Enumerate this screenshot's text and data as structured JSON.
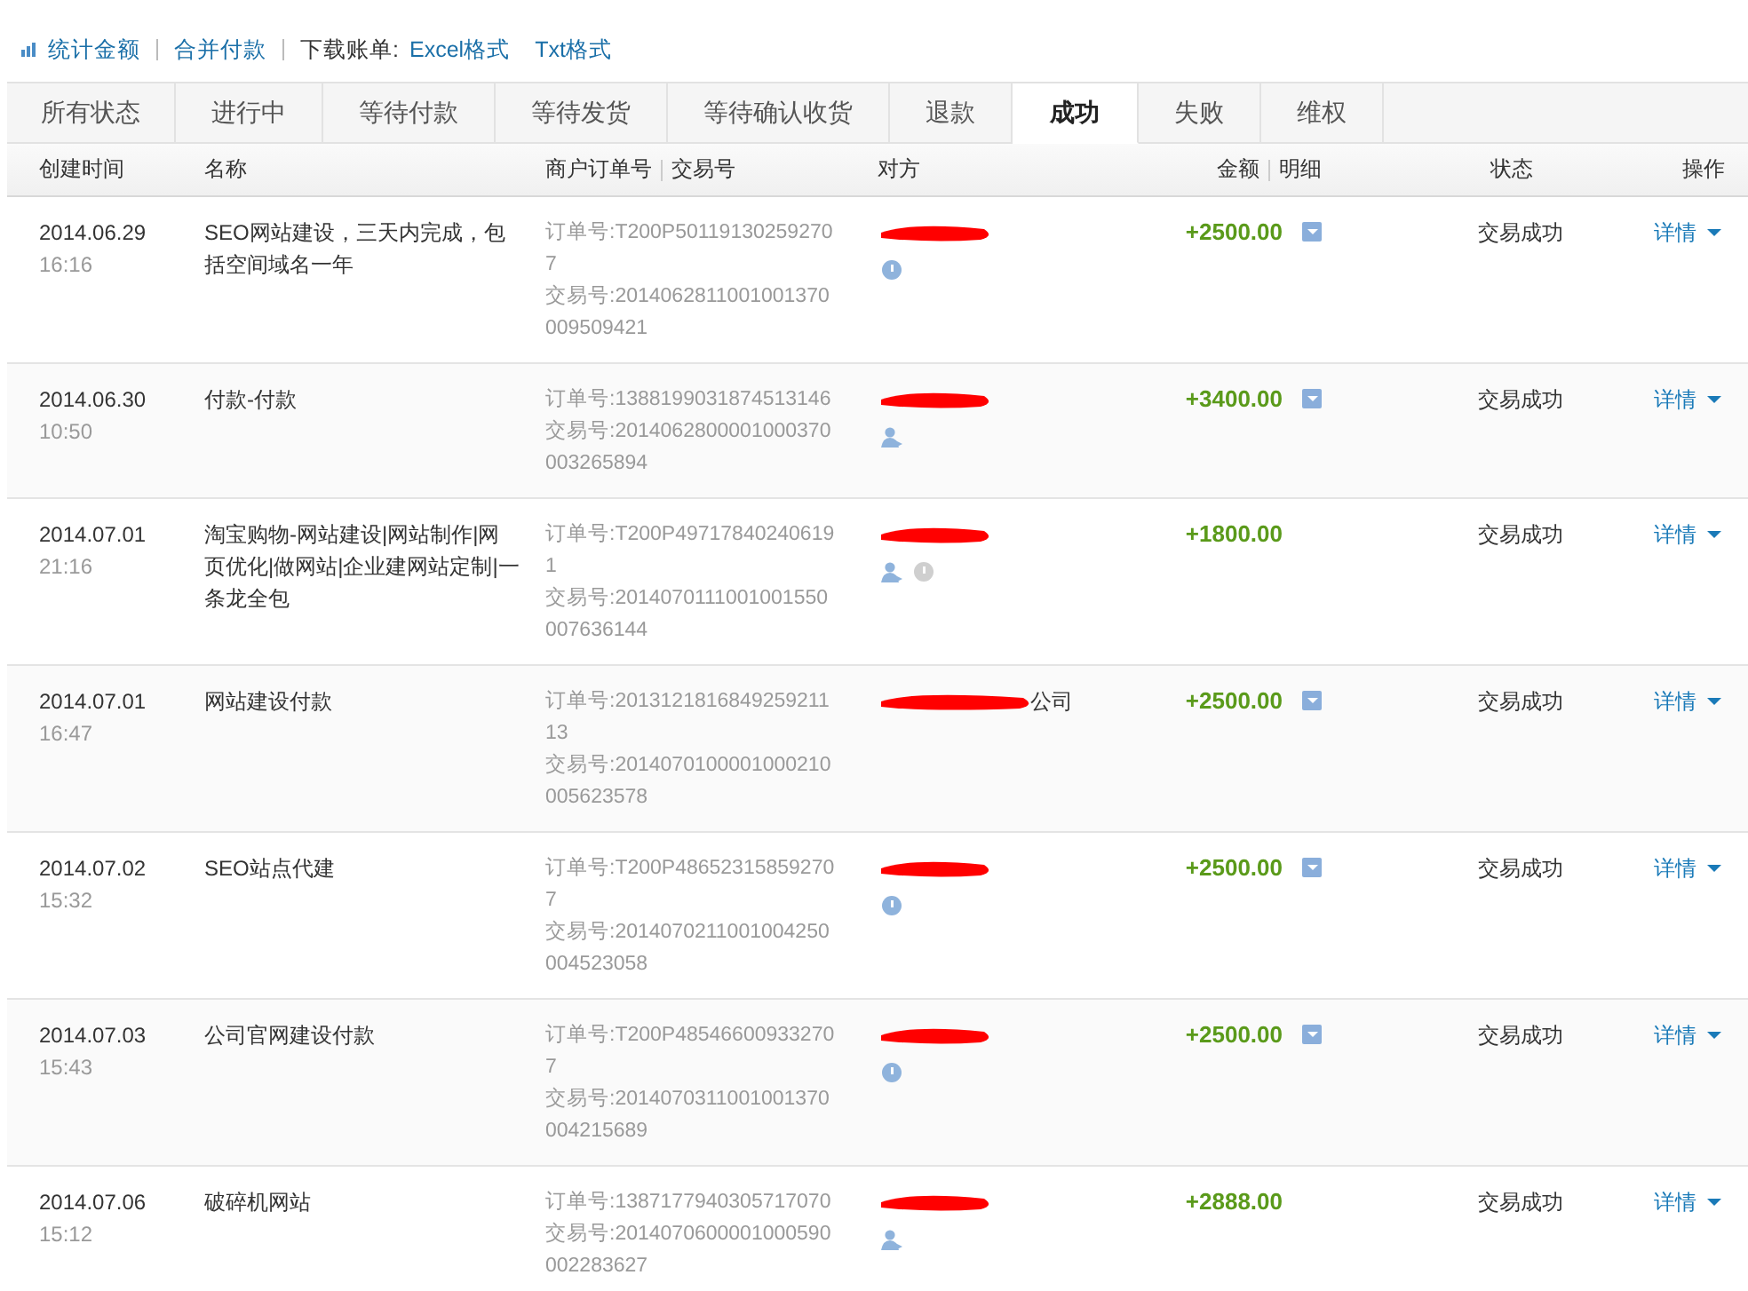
{
  "toolbar": {
    "links": [
      {
        "kind": "stat",
        "label": "统计金额"
      },
      {
        "kind": "link",
        "label": "合并付款"
      }
    ],
    "download_label": "下载账单:",
    "download_links": [
      "Excel格式",
      "Txt格式"
    ]
  },
  "tabs": [
    {
      "label": "所有状态",
      "selected": false
    },
    {
      "label": "进行中",
      "selected": false
    },
    {
      "label": "等待付款",
      "selected": false
    },
    {
      "label": "等待发货",
      "selected": false
    },
    {
      "label": "等待确认收货",
      "selected": false
    },
    {
      "label": "退款",
      "selected": false
    },
    {
      "label": "成功",
      "selected": true
    },
    {
      "label": "失败",
      "selected": false
    },
    {
      "label": "维权",
      "selected": false
    }
  ],
  "table": {
    "columns": {
      "created": "创建时间",
      "name": "名称",
      "order": "商户订单号",
      "trade": "交易号",
      "party": "对方",
      "amount": "金额",
      "detail": "明细",
      "status": "状态",
      "action": "操作"
    },
    "rows": [
      {
        "date": "2014.06.29",
        "time": "16:16",
        "name": "SEO网站建设，三天内完成，包括空间域名一年",
        "order": "订单号:T200P501191302592707",
        "trade": "交易号:2014062811001001370009509421",
        "party_visible": "",
        "party_icons": [
          {
            "kind": "chat"
          }
        ],
        "amount": "+2500.00",
        "has_detail": true,
        "status": "交易成功",
        "action": "详情"
      },
      {
        "date": "2014.06.30",
        "time": "10:50",
        "name": "付款-付款",
        "order": "订单号:1388199031874513146",
        "trade": "交易号:2014062800001000370003265894",
        "party_visible": "",
        "party_icons": [
          {
            "kind": "user"
          }
        ],
        "amount": "+3400.00",
        "has_detail": true,
        "status": "交易成功",
        "action": "详情"
      },
      {
        "date": "2014.07.01",
        "time": "21:16",
        "name": "淘宝购物-网站建设|网站制作|网页优化|做网站|企业建网站定制|一条龙全包",
        "order": "订单号:T200P497178402406191",
        "trade": "交易号:2014070111001001550007636144",
        "party_visible": "",
        "party_icons": [
          {
            "kind": "user"
          },
          {
            "kind": "chat-offline"
          }
        ],
        "amount": "+1800.00",
        "has_detail": false,
        "status": "交易成功",
        "action": "详情"
      },
      {
        "date": "2014.07.01",
        "time": "16:47",
        "name": "网站建设付款",
        "order": "订单号:201312181684925921113",
        "trade": "交易号:2014070100001000210005623578",
        "party_visible": "公司",
        "party_icons": [],
        "amount": "+2500.00",
        "has_detail": true,
        "status": "交易成功",
        "action": "详情"
      },
      {
        "date": "2014.07.02",
        "time": "15:32",
        "name": "SEO站点代建",
        "order": "订单号:T200P486523158592707",
        "trade": "交易号:2014070211001004250004523058",
        "party_visible": "",
        "party_icons": [
          {
            "kind": "chat"
          }
        ],
        "amount": "+2500.00",
        "has_detail": true,
        "status": "交易成功",
        "action": "详情"
      },
      {
        "date": "2014.07.03",
        "time": "15:43",
        "name": "公司官网建设付款",
        "order": "订单号:T200P485466009332707",
        "trade": "交易号:2014070311001001370004215689",
        "party_visible": "",
        "party_icons": [
          {
            "kind": "chat"
          }
        ],
        "amount": "+2500.00",
        "has_detail": true,
        "status": "交易成功",
        "action": "详情"
      },
      {
        "date": "2014.07.06",
        "time": "15:12",
        "name": "破碎机网站",
        "order": "订单号:1387177940305717070",
        "trade": "交易号:2014070600001000590002283627",
        "party_visible": "",
        "party_icons": [
          {
            "kind": "user"
          }
        ],
        "amount": "+2888.00",
        "has_detail": false,
        "status": "交易成功",
        "action": "详情"
      }
    ]
  }
}
